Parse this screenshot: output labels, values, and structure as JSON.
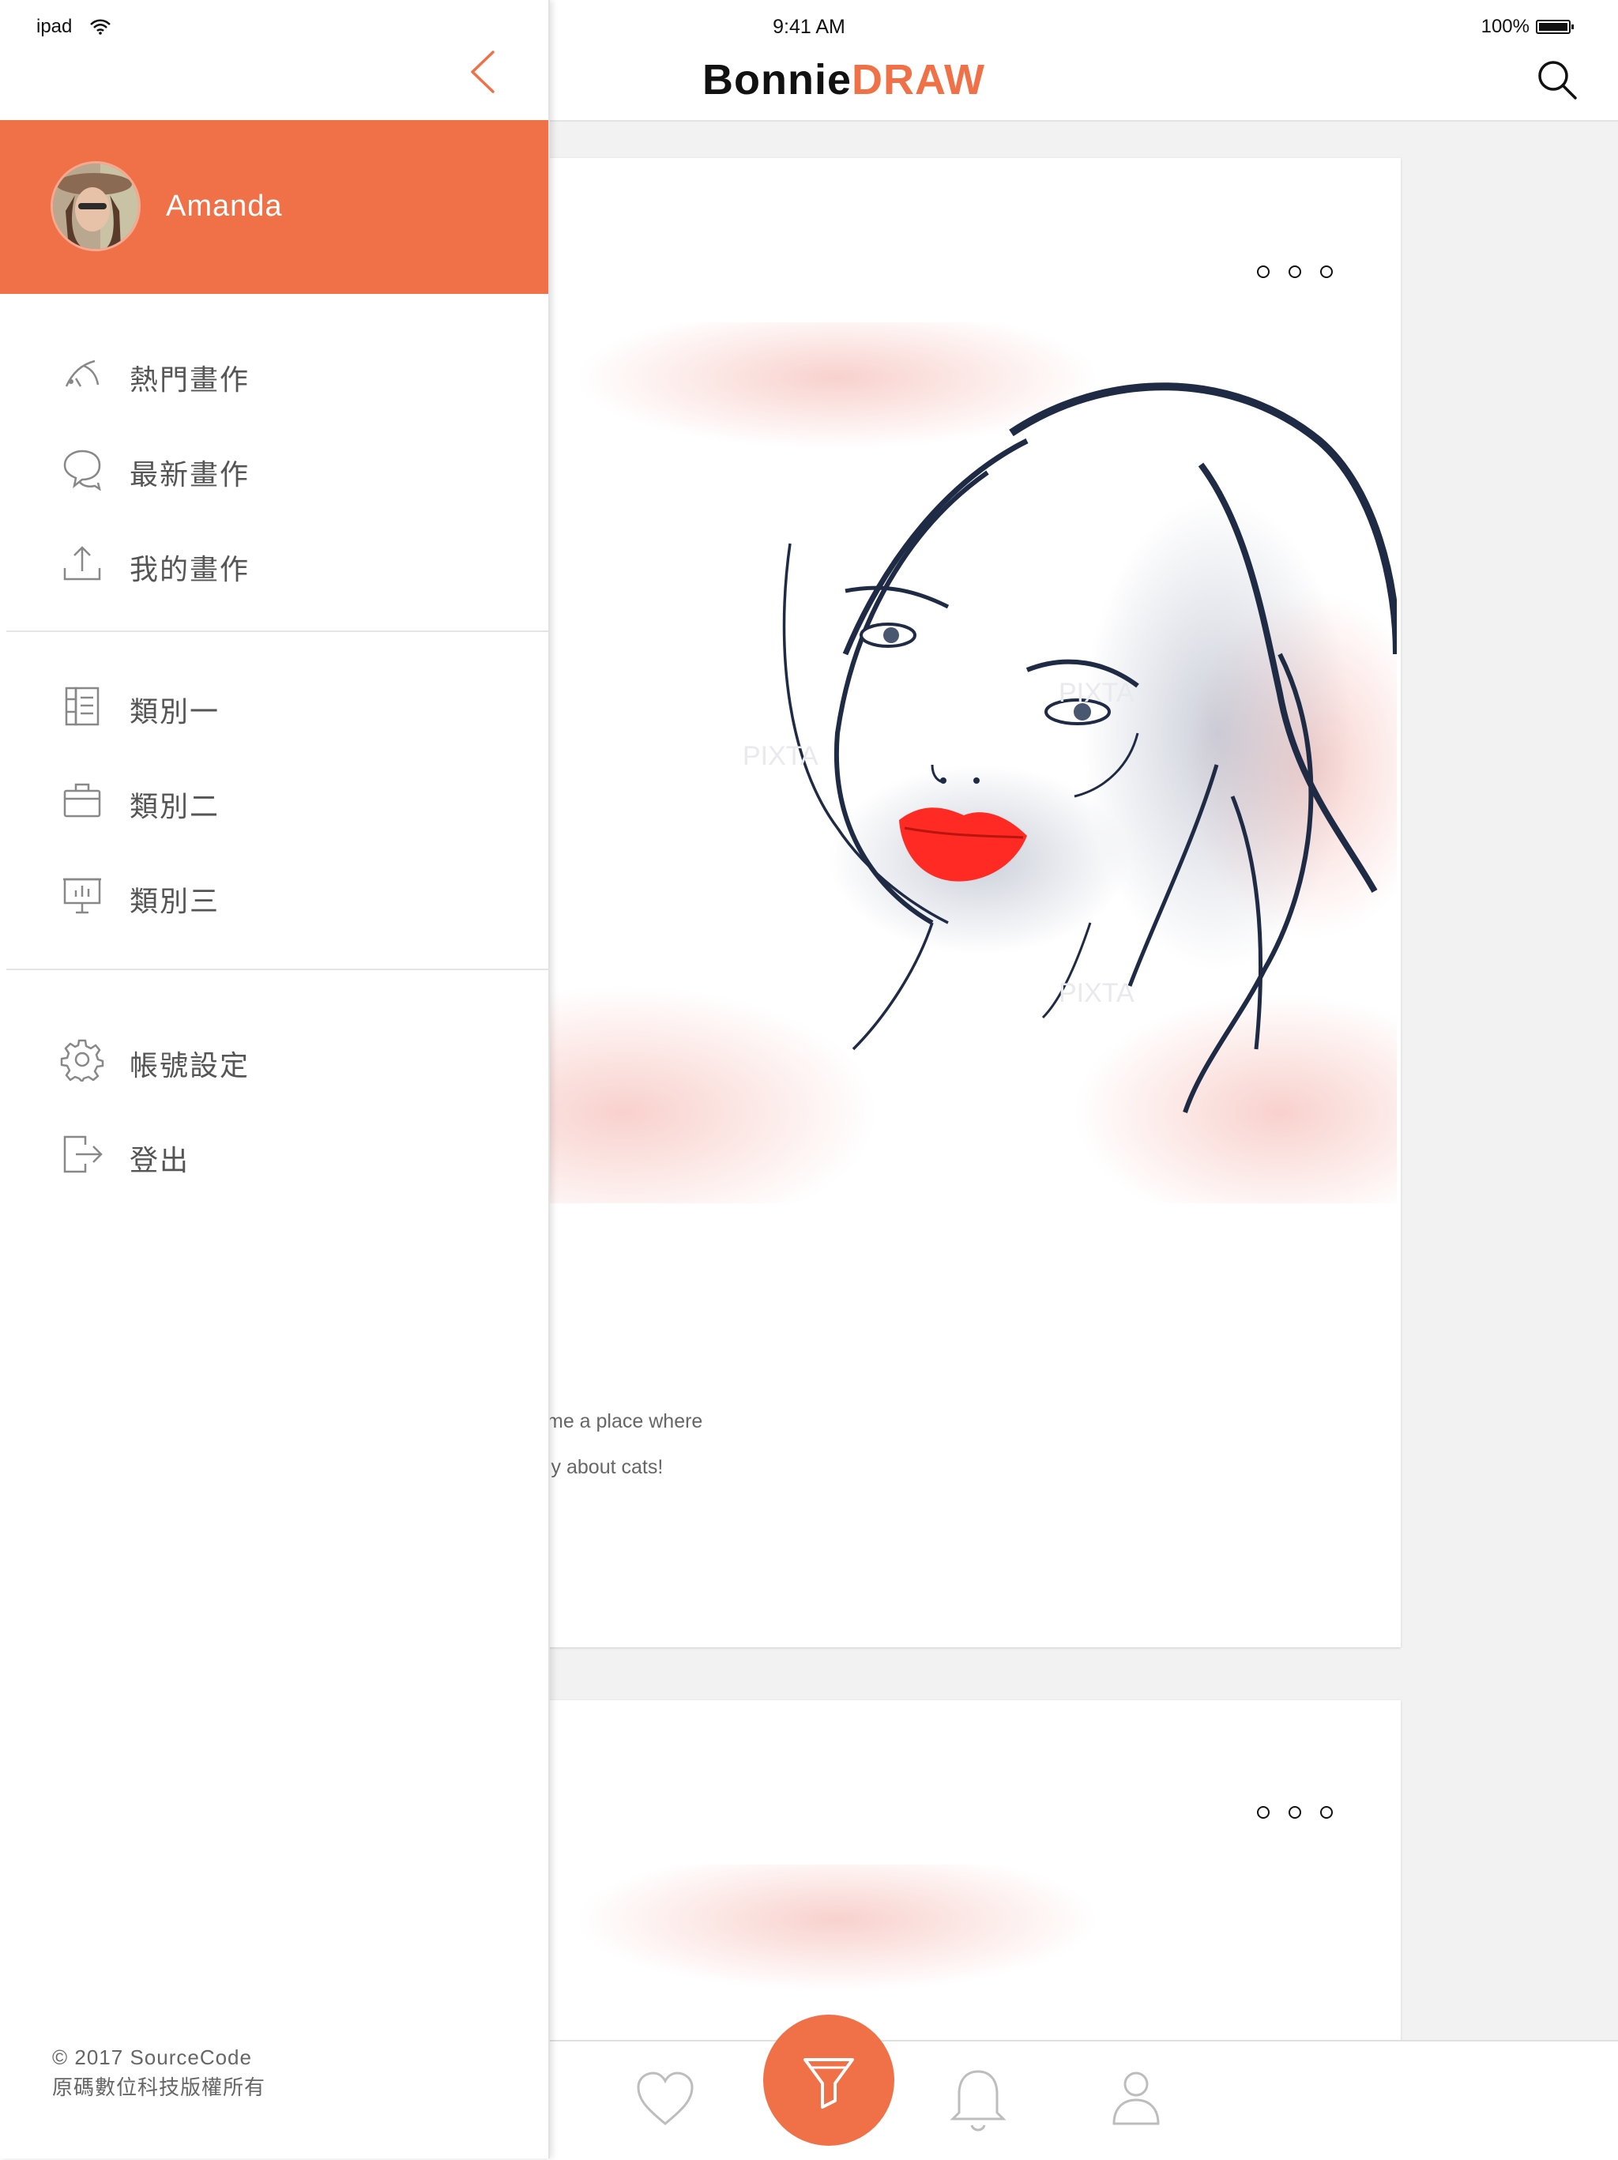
{
  "status_bar": {
    "carrier": "ipad",
    "time": "9:41 AM",
    "battery": "100%"
  },
  "header": {
    "brand_part1": "Bonnie",
    "brand_part2": "DRAW"
  },
  "feed": {
    "cards": [
      {
        "text_line1": "me a place where",
        "text_line2": "ly about cats!",
        "fragment": "/"
      },
      {}
    ]
  },
  "drawer": {
    "user_name": "Amanda",
    "menu_main": [
      {
        "label": "熱門畫作",
        "icon": "trending-icon"
      },
      {
        "label": "最新畫作",
        "icon": "chat-bubbles-icon"
      },
      {
        "label": "我的畫作",
        "icon": "upload-icon"
      }
    ],
    "menu_categories": [
      {
        "label": "類別一",
        "icon": "notebook-icon"
      },
      {
        "label": "類別二",
        "icon": "briefcase-icon"
      },
      {
        "label": "類別三",
        "icon": "presentation-board-icon"
      }
    ],
    "menu_account": [
      {
        "label": "帳號設定",
        "icon": "gear-icon"
      },
      {
        "label": "登出",
        "icon": "logout-icon"
      }
    ],
    "footer_line1": "© 2017 SourceCode",
    "footer_line2": "原碼數位科技版權所有"
  },
  "bottom_bar": {
    "tabs": [
      "heart-icon",
      "brush-icon",
      "bell-icon",
      "profile-icon"
    ]
  },
  "colors": {
    "accent": "#f07048",
    "background": "#f2f2f2",
    "text": "#555555"
  }
}
